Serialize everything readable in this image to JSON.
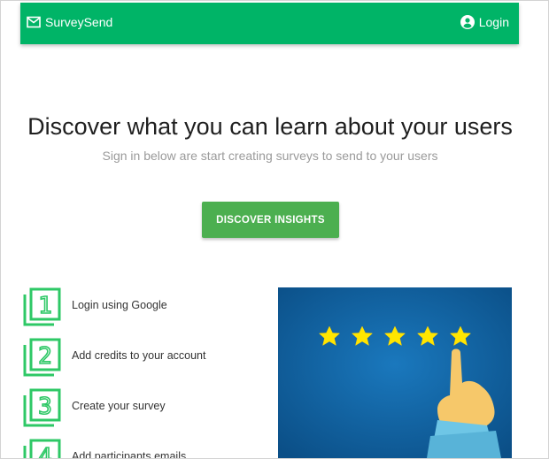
{
  "navbar": {
    "brand": "SurveySend",
    "brand_icon": "mail-icon",
    "login_label": "Login",
    "login_icon": "account-circle-icon",
    "color": "#00b467"
  },
  "hero": {
    "title": "Discover what you can learn about your users",
    "subtitle": "Sign in below are start creating surveys to send to your users",
    "cta_label": "DISCOVER INSIGHTS",
    "cta_color": "#4caf50"
  },
  "steps": [
    {
      "number": "1",
      "label": "Login using Google"
    },
    {
      "number": "2",
      "label": "Add credits to your account"
    },
    {
      "number": "3",
      "label": "Create your survey"
    },
    {
      "number": "4",
      "label": "Add participants emails"
    }
  ],
  "illustration": {
    "name": "five-star-rating-hand",
    "stars": 5,
    "background": "#0f5f9e",
    "star_color": "#ffe600"
  }
}
